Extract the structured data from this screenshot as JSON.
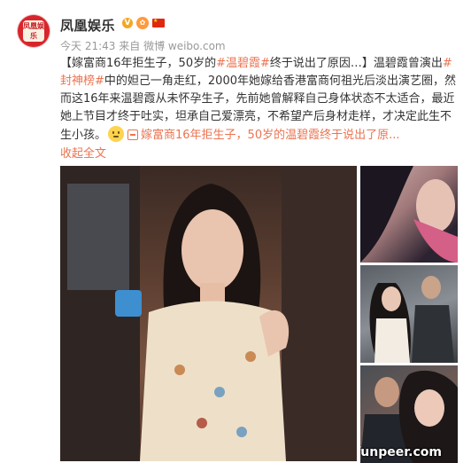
{
  "header": {
    "username": "凤凰娱乐",
    "avatar_text": "凤凰娱乐",
    "time": "今天 21:43",
    "source_prefix": "来自",
    "source": "微博 weibo.com"
  },
  "post": {
    "headline": "【嫁富商16年拒生子，50岁的",
    "topic_1": "#温碧霞#",
    "headline_end": "终于说出了原因…】",
    "text_1": "温碧霞曾演出",
    "topic_2": "#封神榜#",
    "text_2": "中的妲己一角走红，2000年她嫁给香港富商何祖光后淡出演艺圈，然而这16年来温碧霞从未怀孕生子，先前她曾解释自己身体状态不太适合，最近她上节目才终于吐实，坦承自己爱漂亮，不希望产后身材走样，才决定此生不生小孩。",
    "link_text": "嫁富商16年拒生子，50岁的温碧霞终于说出了原...",
    "collapse_label": "收起全文"
  },
  "watermark": "funpeer.com",
  "colors": {
    "link": "#eb7350",
    "text": "#333333",
    "meta": "#999999"
  }
}
